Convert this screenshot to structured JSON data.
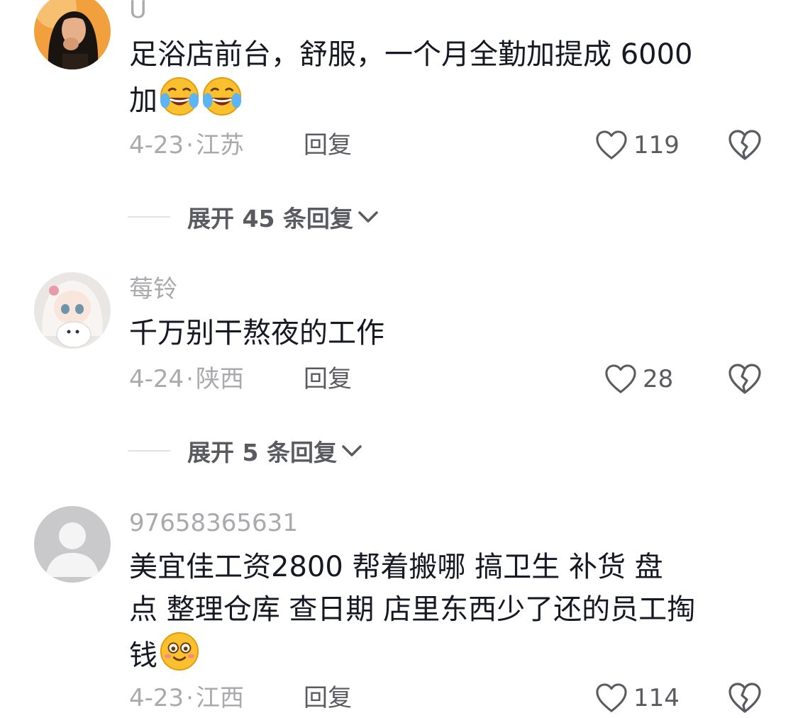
{
  "comments": [
    {
      "username": "U",
      "text_lines": [
        "足浴店前台，舒服，一个月全勤加提成 6000",
        "加"
      ],
      "emojis": [
        "laugh-cry-emoji",
        "laugh-cry-emoji"
      ],
      "date": "4-23",
      "location": "江苏",
      "reply_label": "回复",
      "likes": "119",
      "expand_label": "展开 45 条回复"
    },
    {
      "username": "莓铃",
      "text_lines": [
        "千万别干熬夜的工作"
      ],
      "date": "4-24",
      "location": "陕西",
      "reply_label": "回复",
      "likes": "28",
      "expand_label": "展开 5 条回复"
    },
    {
      "username": "97658365631",
      "text_lines": [
        "美宜佳工资2800  帮着搬哪 搞卫生 补货  盘",
        "点 整理仓库 查日期 店里东西少了还的员工掏",
        "钱"
      ],
      "emojis": [
        "smile-emoji"
      ],
      "date": "4-23",
      "location": "江西",
      "reply_label": "回复",
      "likes": "114"
    }
  ],
  "separator": "·",
  "colors": {
    "text": "#161823",
    "muted": "#a9a9ae",
    "action": "#5a5b60"
  }
}
